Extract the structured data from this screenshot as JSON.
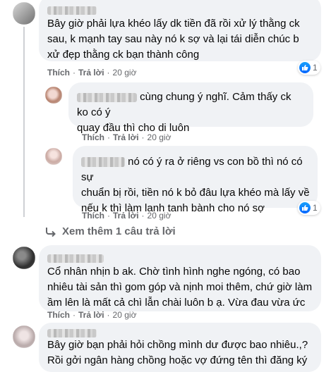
{
  "comments": [
    {
      "text": "Bây giờ phải lựa khéo lấy dk tiền đã rồi xử lý thằng ck sau, k mạnh tay sau này nó k sợ và lại tái diễn chúc b xử đẹp thằng ck bạn thành công",
      "like_label": "Thích",
      "reply_label": "Trả lời",
      "time": "20 giờ",
      "reactions": "1"
    },
    {
      "text_lead": "cùng chung ý nghĩ. Cảm thấy ck ko có ý",
      "text_rest": "quay đầu thì cho di luôn",
      "like_label": "Thích",
      "reply_label": "Trả lời",
      "time": "20 giờ"
    },
    {
      "text_lead": "nó có ý ra ở riêng vs con bồ thì nó có sự",
      "text_rest": "chuẩn bị rồi, tiền nó k bỏ đâu lựa khéo mà lấy về nếu k thì làm lanh tanh bành cho nó sợ",
      "like_label": "Thích",
      "reply_label": "Trả lời",
      "time": "20 giờ",
      "reactions": "1"
    },
    {
      "text": "Cổ nhân nhịn b ak. Chờ tình hình nghe ngóng, có bao nhiêu tài sản thì gom góp và nịnh moi thêm, chứ giờ làm ầm lên là mất cả chì lẫn chài luôn b ạ. Vừa đau vừa ức",
      "like_label": "Thích",
      "reply_label": "Trả lời",
      "time": "20 giờ"
    },
    {
      "text": "Bây giờ bạn phải hỏi chồng mình dư được bao nhiêu.,? Rồi gởi ngân hàng chồng hoặc vợ đứng tên thì đăng ký"
    }
  ],
  "more_replies": "Xem thêm 1 câu trả lời",
  "icons": {
    "like": "thumbs-up-icon",
    "more_replies": "reply-arrow-icon"
  },
  "colors": {
    "bubble": "#f0f2f5",
    "meta": "#65676b",
    "like_blue": "#0866ff"
  }
}
